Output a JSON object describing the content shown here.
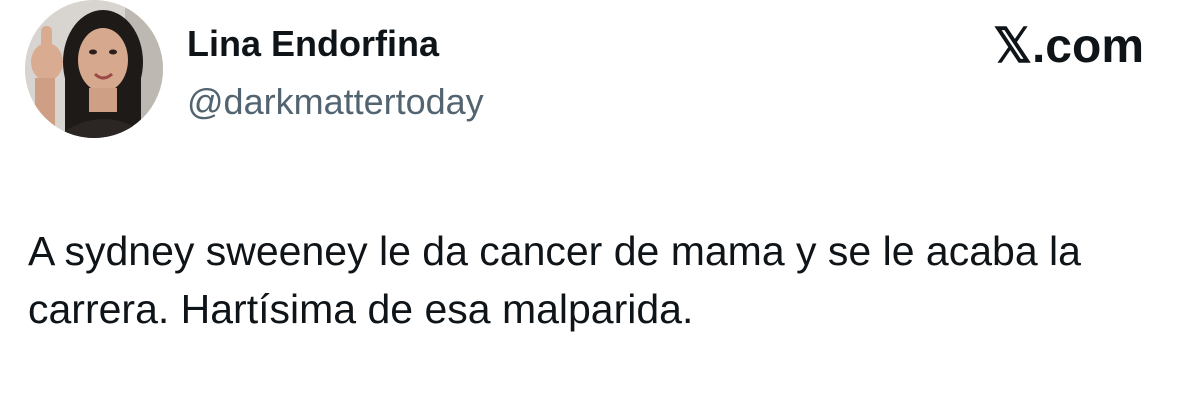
{
  "author": {
    "name": "Lina Endorfina",
    "handle": "@darkmattertoday",
    "avatar_icon": "profile-photo"
  },
  "brand": {
    "label": "𝕏.com"
  },
  "tweet": {
    "text": "A sydney sweeney le da cancer de mama y se le acaba la carrera. Hartísima de esa malparida."
  },
  "colors": {
    "text_primary": "#0f1419",
    "text_secondary": "#536471",
    "background": "#ffffff"
  }
}
